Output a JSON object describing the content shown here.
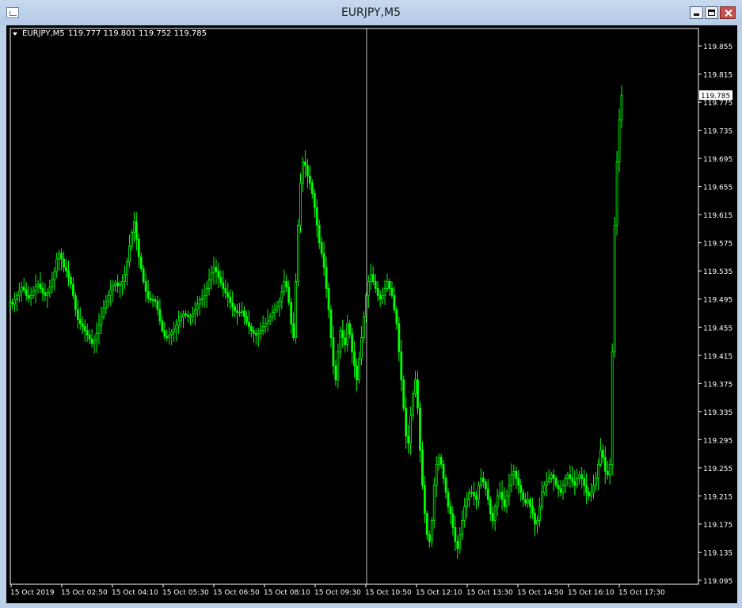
{
  "window": {
    "title": "EURJPY,M5"
  },
  "chart_data": {
    "type": "candlestick",
    "symbol_label": "EURJPY,M5",
    "ohlc_label": "119.777 119.801 119.752 119.785",
    "current_price_label": "119.785",
    "background_color": "#000000",
    "candle_color": "#00ff00",
    "grid": false,
    "ylim": [
      119.095,
      119.875
    ],
    "y_ticks": [
      "119.855",
      "119.815",
      "119.775",
      "119.735",
      "119.695",
      "119.655",
      "119.615",
      "119.575",
      "119.535",
      "119.495",
      "119.455",
      "119.415",
      "119.375",
      "119.335",
      "119.295",
      "119.255",
      "119.215",
      "119.175",
      "119.135",
      "119.095"
    ],
    "x_ticks": [
      "15 Oct 2019",
      "15 Oct 02:50",
      "15 Oct 04:10",
      "15 Oct 05:30",
      "15 Oct 06:50",
      "15 Oct 08:10",
      "15 Oct 09:30",
      "15 Oct 10:50",
      "15 Oct 12:10",
      "15 Oct 13:30",
      "15 Oct 14:50",
      "15 Oct 16:10",
      "15 Oct 17:30"
    ],
    "crosshair_time": "15 Oct 10:50",
    "close": [
      119.49,
      119.488,
      119.494,
      119.5,
      119.506,
      119.512,
      119.508,
      119.5,
      119.496,
      119.5,
      119.507,
      119.513,
      119.516,
      119.51,
      119.504,
      119.5,
      119.504,
      119.512,
      119.522,
      119.534,
      119.552,
      119.56,
      119.552,
      119.54,
      119.535,
      119.526,
      119.516,
      119.5,
      119.48,
      119.466,
      119.46,
      119.456,
      119.45,
      119.444,
      119.438,
      119.432,
      119.436,
      119.446,
      119.458,
      119.47,
      119.482,
      119.492,
      119.5,
      119.508,
      119.514,
      119.518,
      119.514,
      119.516,
      119.52,
      119.53,
      119.548,
      119.57,
      119.59,
      119.605,
      119.58,
      119.555,
      119.538,
      119.52,
      119.506,
      119.496,
      119.494,
      119.494,
      119.492,
      119.48,
      119.464,
      119.45,
      119.442,
      119.44,
      119.444,
      119.448,
      119.452,
      119.458,
      119.464,
      119.47,
      119.474,
      119.472,
      119.47,
      119.47,
      119.474,
      119.48,
      119.488,
      119.494,
      119.496,
      119.5,
      119.51,
      119.522,
      119.532,
      119.54,
      119.534,
      119.526,
      119.518,
      119.51,
      119.504,
      119.498,
      119.49,
      119.484,
      119.478,
      119.476,
      119.476,
      119.478,
      119.47,
      119.462,
      119.456,
      119.45,
      119.446,
      119.444,
      119.446,
      119.45,
      119.456,
      119.46,
      119.464,
      119.47,
      119.476,
      119.48,
      119.484,
      119.492,
      119.505,
      119.52,
      119.512,
      119.49,
      119.46,
      119.44,
      119.52,
      119.6,
      119.66,
      119.69,
      119.685,
      119.67,
      119.66,
      119.645,
      119.625,
      119.6,
      119.575,
      119.56,
      119.54,
      119.51,
      119.48,
      119.44,
      119.4,
      119.38,
      119.42,
      119.45,
      119.44,
      119.43,
      119.46,
      119.445,
      119.42,
      119.4,
      119.38,
      119.41,
      119.44,
      119.47,
      119.5,
      119.52,
      119.53,
      119.52,
      119.51,
      119.5,
      119.495,
      119.5,
      119.51,
      119.52,
      119.51,
      119.5,
      119.48,
      119.46,
      119.42,
      119.38,
      119.34,
      119.3,
      119.29,
      119.33,
      119.36,
      119.38,
      119.34,
      119.28,
      119.23,
      119.19,
      119.16,
      119.15,
      119.18,
      119.23,
      119.26,
      119.27,
      119.26,
      119.24,
      119.22,
      119.2,
      119.19,
      119.17,
      119.15,
      119.14,
      119.16,
      119.18,
      119.2,
      119.21,
      119.22,
      119.22,
      119.215,
      119.21,
      119.23,
      119.24,
      119.235,
      119.225,
      119.21,
      119.19,
      119.18,
      119.2,
      119.215,
      119.22,
      119.21,
      119.2,
      119.215,
      119.23,
      119.245,
      119.25,
      119.24,
      119.23,
      119.22,
      119.21,
      119.205,
      119.21,
      119.2,
      119.19,
      119.175,
      119.18,
      119.2,
      119.22,
      119.23,
      119.235,
      119.24,
      119.245,
      119.24,
      119.23,
      119.225,
      119.22,
      119.23,
      119.24,
      119.245,
      119.24,
      119.235,
      119.23,
      119.24,
      119.245,
      119.24,
      119.23,
      119.22,
      119.215,
      119.22,
      119.23,
      119.24,
      119.26,
      119.28,
      119.27,
      119.25,
      119.245,
      119.26,
      119.42,
      119.6,
      119.69,
      119.75,
      119.785
    ]
  }
}
